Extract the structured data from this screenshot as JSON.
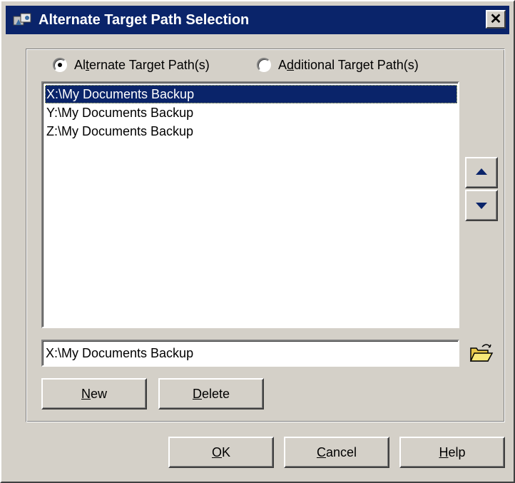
{
  "window": {
    "title": "Alternate Target Path Selection",
    "close_glyph": "✕"
  },
  "radios": {
    "alternate": {
      "label_pre": "Al",
      "label_key": "t",
      "label_post": "ernate Target Path(s)",
      "checked": true
    },
    "additional": {
      "label_pre": "A",
      "label_key": "d",
      "label_post": "ditional Target Path(s)",
      "checked": false
    }
  },
  "paths": [
    {
      "label": "X:\\My Documents Backup",
      "selected": true
    },
    {
      "label": "Y:\\My Documents Backup",
      "selected": false
    },
    {
      "label": "Z:\\My Documents Backup",
      "selected": false
    }
  ],
  "path_field": {
    "value": "X:\\My Documents Backup"
  },
  "buttons": {
    "new": {
      "key": "N",
      "rest": "ew"
    },
    "delete": {
      "key": "D",
      "rest": "elete"
    },
    "ok": {
      "key": "O",
      "rest": "K"
    },
    "cancel": {
      "key": "C",
      "rest": "ancel"
    },
    "help": {
      "key": "H",
      "rest": "elp"
    }
  },
  "icons": {
    "title": "app-icon",
    "move_up": "arrow-up-icon",
    "move_down": "arrow-down-icon",
    "browse": "open-folder-icon"
  },
  "colors": {
    "titlebar": "#0a246a",
    "selection": "#0a246a",
    "face": "#d4d0c8"
  }
}
